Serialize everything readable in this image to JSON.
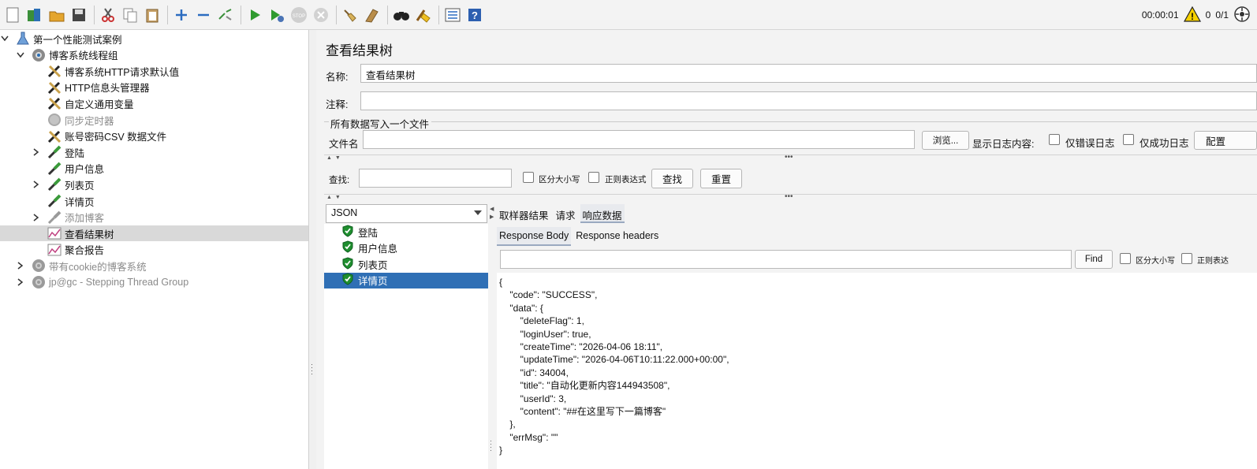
{
  "toolbar": {
    "icons": [
      "new-icon",
      "templates-icon",
      "open-icon",
      "save-icon",
      "cut-icon",
      "copy-icon",
      "paste-icon",
      "expand-icon",
      "collapse-icon",
      "toggle-icon",
      "start-icon",
      "start-no-timers-icon",
      "stop-icon",
      "shutdown-icon",
      "clear-icon",
      "clear-all-icon",
      "search-icon",
      "reset-search-icon",
      "function-helper-icon",
      "help-icon"
    ],
    "timer": "00:00:01",
    "warnings": "0",
    "threads": "0/1"
  },
  "tree": {
    "items": [
      {
        "label": "第一个性能测试案例",
        "icon": "test-plan-icon",
        "level": 0,
        "chevron": "down",
        "disabled": false
      },
      {
        "label": "博客系统线程组",
        "icon": "thread-group-icon",
        "level": 1,
        "chevron": "down",
        "disabled": false
      },
      {
        "label": "博客系统HTTP请求默认值",
        "icon": "config-icon",
        "level": 2,
        "chevron": "",
        "disabled": false
      },
      {
        "label": "HTTP信息头管理器",
        "icon": "config-icon",
        "level": 2,
        "chevron": "",
        "disabled": false
      },
      {
        "label": "自定义通用变量",
        "icon": "config-icon",
        "level": 2,
        "chevron": "",
        "disabled": false
      },
      {
        "label": "同步定时器",
        "icon": "timer-icon",
        "level": 2,
        "chevron": "",
        "disabled": true
      },
      {
        "label": "账号密码CSV 数据文件",
        "icon": "config-icon",
        "level": 2,
        "chevron": "",
        "disabled": false
      },
      {
        "label": "登陆",
        "icon": "sampler-icon",
        "level": 2,
        "chevron": "right",
        "disabled": false
      },
      {
        "label": "用户信息",
        "icon": "sampler-icon",
        "level": 2,
        "chevron": "",
        "disabled": false
      },
      {
        "label": "列表页",
        "icon": "sampler-icon",
        "level": 2,
        "chevron": "right",
        "disabled": false
      },
      {
        "label": "详情页",
        "icon": "sampler-icon",
        "level": 2,
        "chevron": "",
        "disabled": false
      },
      {
        "label": "添加博客",
        "icon": "sampler-icon",
        "level": 2,
        "chevron": "right",
        "disabled": true
      },
      {
        "label": "查看结果树",
        "icon": "listener-icon",
        "level": 2,
        "chevron": "",
        "disabled": false,
        "selected": true
      },
      {
        "label": "聚合报告",
        "icon": "listener-icon",
        "level": 2,
        "chevron": "",
        "disabled": false
      },
      {
        "label": "带有cookie的博客系统",
        "icon": "thread-group-icon",
        "level": 1,
        "chevron": "right",
        "disabled": true
      },
      {
        "label": "jp@gc - Stepping Thread Group",
        "icon": "thread-group-icon",
        "level": 1,
        "chevron": "right",
        "disabled": true
      }
    ]
  },
  "panel": {
    "title": "查看结果树",
    "name_label": "名称:",
    "name_value": "查看结果树",
    "comment_label": "注释:",
    "comment_value": "",
    "fieldset_title": "所有数据写入一个文件",
    "filename_label": "文件名",
    "filename_value": "",
    "browse_button": "浏览...",
    "log_label": "显示日志内容:",
    "errors_only": "仅错误日志",
    "success_only": "仅成功日志",
    "configure_button": "配置",
    "search_label": "查找:",
    "search_value": "",
    "case_sensitive": "区分大小写",
    "regex": "正则表达式",
    "find_button": "查找",
    "reset_button": "重置"
  },
  "renderer": {
    "selected": "JSON"
  },
  "results": [
    {
      "label": "登陆",
      "status": "success",
      "selected": false
    },
    {
      "label": "用户信息",
      "status": "success",
      "selected": false
    },
    {
      "label": "列表页",
      "status": "success",
      "selected": false
    },
    {
      "label": "详情页",
      "status": "success",
      "selected": true
    }
  ],
  "tabs": {
    "main": [
      {
        "label": "取样器结果",
        "active": false
      },
      {
        "label": "请求",
        "active": false
      },
      {
        "label": "响应数据",
        "active": true
      }
    ],
    "sub": [
      {
        "label": "Response Body",
        "active": true
      },
      {
        "label": "Response headers",
        "active": false
      }
    ]
  },
  "response_search": {
    "value": "",
    "find_button": "Find",
    "case_sensitive": "区分大小写",
    "regex": "正则表达"
  },
  "response_body": [
    "{",
    "    \"code\": \"SUCCESS\",",
    "    \"data\": {",
    "        \"deleteFlag\": 1,",
    "        \"loginUser\": true,",
    "        \"createTime\": \"2026-04-06 18:11\",",
    "        \"updateTime\": \"2026-04-06T10:11:22.000+00:00\",",
    "        \"id\": 34004,",
    "        \"title\": \"自动化更新内容144943508\",",
    "        \"userId\": 3,",
    "        \"content\": \"##在这里写下一篇博客\"",
    "    },",
    "    \"errMsg\": \"\"",
    "}"
  ]
}
